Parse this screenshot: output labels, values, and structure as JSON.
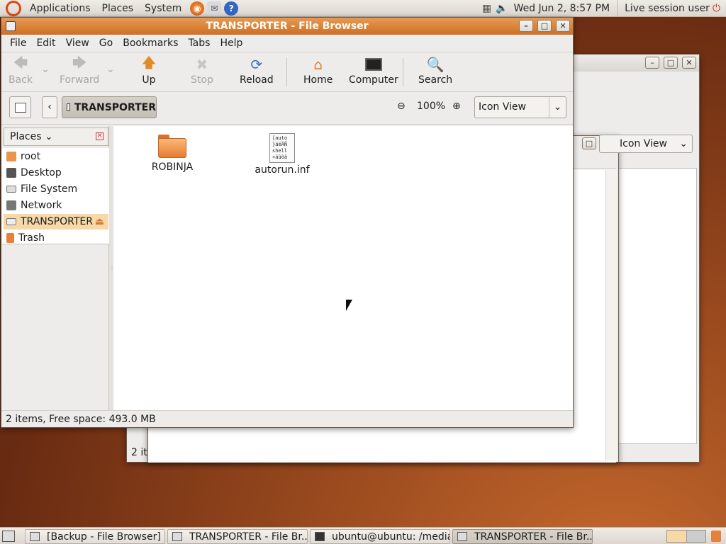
{
  "top_panel": {
    "menus": [
      "Applications",
      "Places",
      "System"
    ],
    "clock": "Wed Jun  2,  8:57 PM",
    "user": "Live session user"
  },
  "back_window": {
    "view_label": "Icon View",
    "status_prefix": "2 it"
  },
  "main_window": {
    "title": "TRANSPORTER - File Browser",
    "menu": [
      "File",
      "Edit",
      "View",
      "Go",
      "Bookmarks",
      "Tabs",
      "Help"
    ],
    "toolbar": {
      "back": "Back",
      "forward": "Forward",
      "up": "Up",
      "stop": "Stop",
      "reload": "Reload",
      "home": "Home",
      "computer": "Computer",
      "search": "Search"
    },
    "location": "TRANSPORTER",
    "zoom": "100%",
    "view_mode": "Icon View",
    "sidebar_title": "Places",
    "places": [
      "root",
      "Desktop",
      "File System",
      "Network",
      "TRANSPORTER",
      "Trash"
    ],
    "files": [
      {
        "name": "ROBINJA",
        "type": "folder"
      },
      {
        "name": "autorun.inf",
        "type": "text",
        "preview": "[auto\n}äëÄÑ\nshell\n+äûõâ"
      }
    ],
    "status": "2 items, Free space: 493.0 MB"
  },
  "taskbar": {
    "tasks": [
      "[Backup - File Browser]",
      "TRANSPORTER - File Br...",
      "ubuntu@ubuntu: /media",
      "TRANSPORTER - File Br..."
    ]
  },
  "colors": {
    "accent": "#d77a30",
    "selected": "#f6d9a6",
    "panel": "#e6e1db"
  }
}
